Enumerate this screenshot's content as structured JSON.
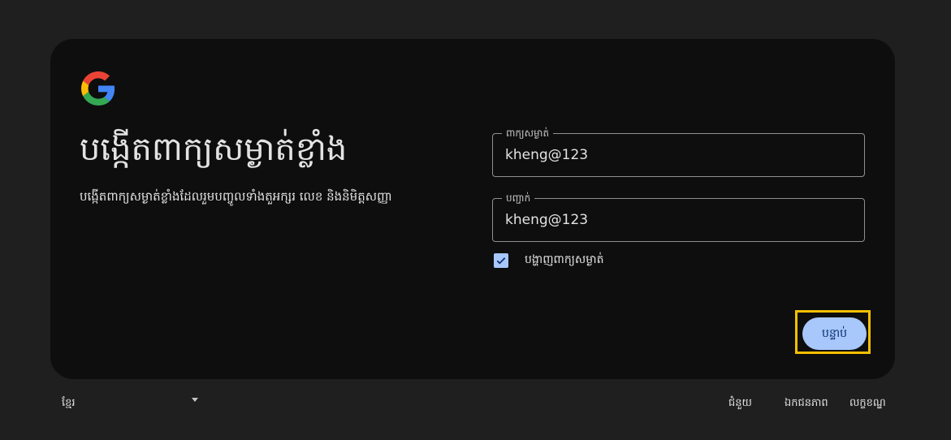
{
  "page": {
    "title": "បង្កើតពាក្យសម្ងាត់ខ្លាំង",
    "subtitle": "បង្កើតពាក្យសម្ងាត់ខ្លាំងដែលរួមបញ្ចូលទាំងតួអក្សរ លេខ និងនិមិត្តសញ្ញា"
  },
  "form": {
    "password_label": "ពាក្យសម្ងាត់",
    "password_value": "kheng@123",
    "confirm_label": "បញ្ជាក់",
    "confirm_value": "kheng@123",
    "show_password_label": "បង្ហាញពាក្យសម្ងាត់",
    "show_password_checked": true,
    "next_label": "បន្ទាប់"
  },
  "footer": {
    "language": "ខ្មែរ",
    "help": "ជំនួយ",
    "privacy": "ឯកជនភាព",
    "terms": "លក្ខខណ្ឌ"
  },
  "colors": {
    "background": "#1f1f1f",
    "card": "#0e0e0e",
    "accent": "#a8c7fa",
    "highlight": "#f5c000"
  },
  "icons": [
    "google-logo",
    "check-icon",
    "caret-down-icon"
  ]
}
